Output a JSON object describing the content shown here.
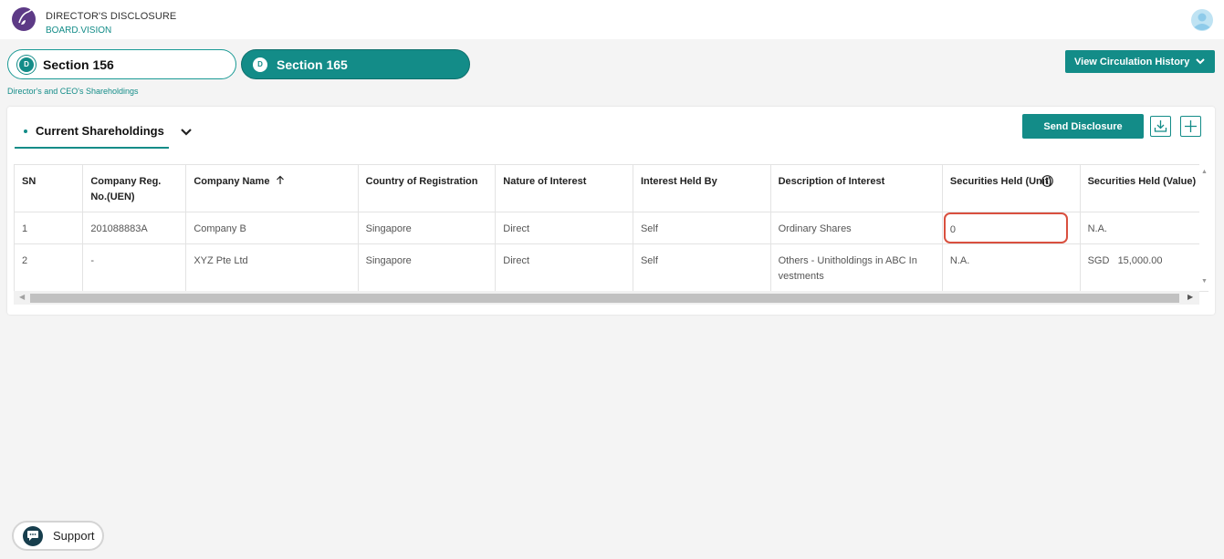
{
  "header": {
    "app_title": "DIRECTOR'S DISCLOSURE",
    "app_subtitle": "BOARD.VISION"
  },
  "sections": [
    {
      "badge": "D",
      "label": "Section 156",
      "active": false
    },
    {
      "badge": "D",
      "label": "Section 165",
      "active": true
    }
  ],
  "view_history_label": "View Circulation History",
  "subtitle": "Director's and CEO's Shareholdings",
  "card": {
    "tab_label": "Current Shareholdings",
    "send_label": "Send Disclosure"
  },
  "table": {
    "columns": [
      "SN",
      "Company Reg. No.(UEN)",
      "Company Name",
      "Country of Registration",
      "Nature of Interest",
      "Interest Held By",
      "Description of Interest",
      "Securities Held (Unit)",
      "Securities Held (Value)"
    ],
    "rows": [
      [
        "1",
        "201088883A",
        "Company B",
        "Singapore",
        "Direct",
        "Self",
        "Ordinary Shares",
        "0",
        "N.A."
      ],
      [
        "2",
        "-",
        "XYZ Pte Ltd",
        "Singapore",
        "Direct",
        "Self",
        "Others - Unitholdings in ABC In vestments",
        "N.A.",
        "SGD   15,000.00"
      ]
    ]
  },
  "support_label": "Support",
  "colors": {
    "accent": "#138c88",
    "highlight": "#d9503f",
    "background": "#f4f4f4"
  }
}
